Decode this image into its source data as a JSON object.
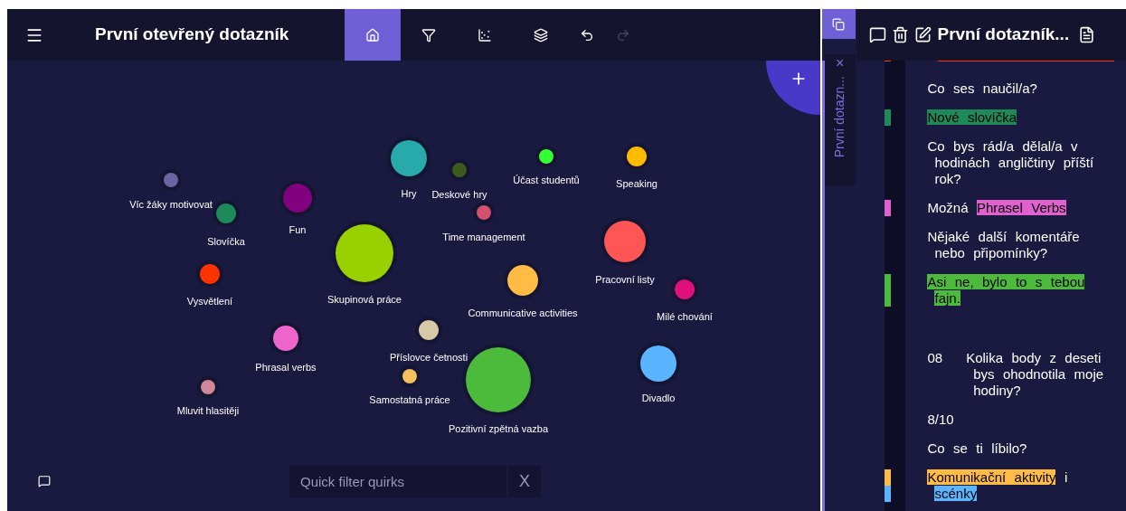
{
  "header": {
    "title": "První otevřený dotazník"
  },
  "toolbar": [
    {
      "kind": "home",
      "selected": true,
      "disabled": false
    },
    {
      "kind": "filter",
      "selected": false,
      "disabled": false
    },
    {
      "kind": "scatter",
      "selected": false,
      "disabled": false
    },
    {
      "kind": "layers",
      "selected": false,
      "disabled": false
    },
    {
      "kind": "undo",
      "selected": false,
      "disabled": false
    },
    {
      "kind": "redo",
      "selected": false,
      "disabled": true
    }
  ],
  "bubbles": [
    {
      "label": "Víc žáky motivovat",
      "color": "#6b64a0"
    },
    {
      "label": "Slovíčka",
      "color": "#1e8a5a"
    },
    {
      "label": "Fun",
      "color": "#800080"
    },
    {
      "label": "Hry",
      "color": "#28aaaa"
    },
    {
      "label": "Deskové hry",
      "color": "#3d5a1e"
    },
    {
      "label": "Účast studentů",
      "color": "#33ff33"
    },
    {
      "label": "Speaking",
      "color": "#ffbb00"
    },
    {
      "label": "Time management",
      "color": "#d65070"
    },
    {
      "label": "Vysvětlení",
      "color": "#ff3300"
    },
    {
      "label": "Skupinová práce",
      "color": "#99d100"
    },
    {
      "label": "Pracovní listy",
      "color": "#ff5555"
    },
    {
      "label": "Communicative activities",
      "color": "#ffbb44"
    },
    {
      "label": "Milé chování",
      "color": "#e0107a"
    },
    {
      "label": "Phrasal verbs",
      "color": "#ee66cc"
    },
    {
      "label": "Příslovce četnosti",
      "color": "#d8c8a8"
    },
    {
      "label": "Samostatná práce",
      "color": "#f5c060"
    },
    {
      "label": "Pozitivní zpětná vazba",
      "color": "#4cbb3c"
    },
    {
      "label": "Divadlo",
      "color": "#5ab4ff"
    },
    {
      "label": "Mluvit hlasitěji",
      "color": "#d08898"
    }
  ],
  "filter": {
    "placeholder": "Quick filter quirks",
    "clear": "X"
  },
  "side_tab": {
    "label": "První dotazn...",
    "close": "×"
  },
  "document": {
    "title": "První dotazník...",
    "entries": [
      {
        "kind": "clipped",
        "color": "#ff3300"
      },
      {
        "kind": "question",
        "text": "Co ses naučil/a?"
      },
      {
        "kind": "answer",
        "segments": [
          {
            "text": "Nové slovíčka",
            "color": "#1e8a5a"
          }
        ]
      },
      {
        "kind": "question",
        "text": "Co bys rád/a dělal/a v hodinách angličtiny příští rok?"
      },
      {
        "kind": "answer",
        "segments": [
          {
            "text": "Možná "
          },
          {
            "text": "Phrasel Verbs",
            "color": "#e060d0"
          }
        ]
      },
      {
        "kind": "question",
        "text": "Nějaké další komentáře nebo připomínky?"
      },
      {
        "kind": "answer",
        "segments": [
          {
            "text": "Asi ne, bylo to s tebou fajn.",
            "color": "#4cbb3c"
          }
        ]
      },
      {
        "kind": "numbered",
        "number": "08",
        "text": "Kolika body z deseti bys ohodnotila moje hodiny?"
      },
      {
        "kind": "question",
        "text": "8/10"
      },
      {
        "kind": "question",
        "text": "Co se ti líbilo?"
      },
      {
        "kind": "answer",
        "segments": [
          {
            "text": "Komunikační aktivity",
            "color": "#ffbb44"
          },
          {
            "text": " i "
          },
          {
            "text": "scénky",
            "color": "#5ab4ff"
          }
        ]
      }
    ]
  }
}
